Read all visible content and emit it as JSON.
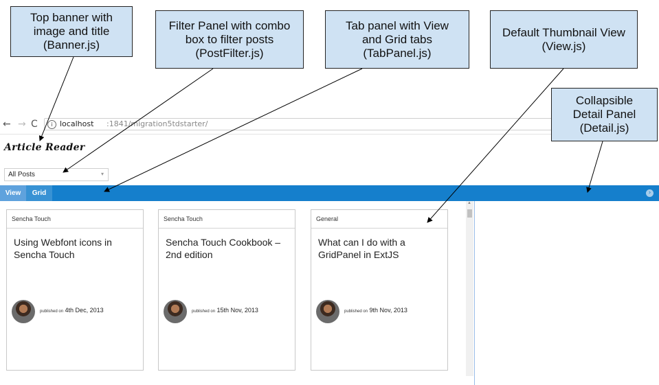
{
  "callouts": {
    "banner": "Top banner with\nimage and title\n(Banner.js)",
    "filter": "Filter Panel with combo\nbox to filter posts\n(PostFilter.js)",
    "tabs": "Tab panel with View\nand Grid tabs\n(TabPanel.js)",
    "view": "Default Thumbnail View\n(View.js)",
    "detail": "Collapsible\nDetail Panel\n(Detail.js)"
  },
  "browser": {
    "back_icon": "←",
    "forward_icon": "→",
    "reload_icon": "C",
    "info_icon": "i",
    "url_host": "localhost",
    "url_path": ":1841/migration5tdstarter/"
  },
  "app": {
    "title": "Article Reader"
  },
  "filter": {
    "value": "All Posts",
    "arrow_icon": "▾"
  },
  "tabs": [
    {
      "label": "View"
    },
    {
      "label": "Grid"
    }
  ],
  "detail": {
    "collapse_icon": "›"
  },
  "posts": [
    {
      "category": "Sencha Touch",
      "title": "Using Webfont icons in Sencha Touch",
      "published_label": "published on",
      "date": "4th Dec, 2013"
    },
    {
      "category": "Sencha Touch",
      "title": "Sencha Touch Cookbook – 2nd edition",
      "published_label": "published on",
      "date": "15th Nov, 2013"
    },
    {
      "category": "General",
      "title": "What can I do with a GridPanel in ExtJS",
      "published_label": "published on",
      "date": "9th Nov, 2013"
    }
  ],
  "scrollbar": {
    "up_icon": "▲"
  }
}
